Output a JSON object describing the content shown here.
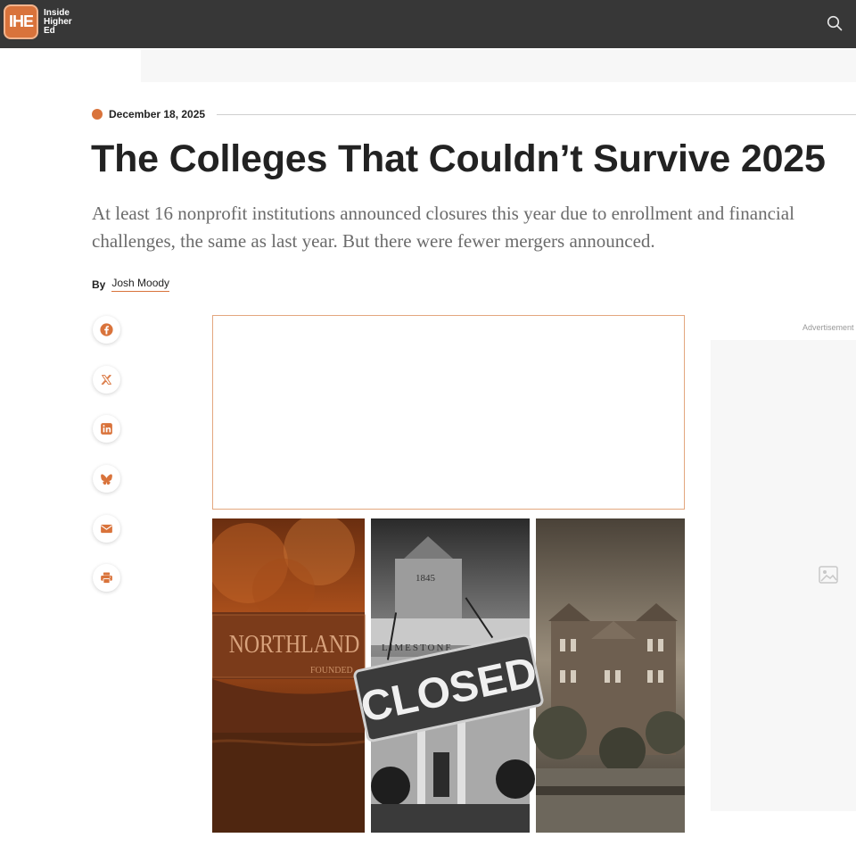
{
  "site": {
    "logo_mark": "IHE",
    "logo_lines": [
      "Inside",
      "Higher",
      "Ed"
    ],
    "search_icon": "search-icon"
  },
  "colors": {
    "header_bg": "#373737",
    "accent": "#d9733b",
    "headline": "#222222",
    "dek": "#6b6b6b"
  },
  "article": {
    "date": "December 18, 2025",
    "headline": "The Colleges That Couldn’t Survive 2025",
    "dek": "At least 16 nonprofit institutions announced closures this year due to enrollment and financial challenges, the same as last year. But there were fewer mergers announced.",
    "by_label": "By",
    "author": "Josh Moody"
  },
  "share": [
    {
      "icon": "facebook-icon"
    },
    {
      "icon": "x-icon"
    },
    {
      "icon": "linkedin-icon"
    },
    {
      "icon": "bluesky-icon"
    },
    {
      "icon": "email-icon"
    },
    {
      "icon": "print-icon"
    }
  ],
  "hero": {
    "panel_left_text": "NORTHLAND",
    "panel_left_subtext": "FOUNDED",
    "panel_mid_year": "1845",
    "panel_mid_text": "LIMESTONE",
    "sign_text": "CLOSED"
  },
  "sidebar": {
    "ad_label": "Advertisement",
    "image_icon": "image-placeholder-icon"
  }
}
